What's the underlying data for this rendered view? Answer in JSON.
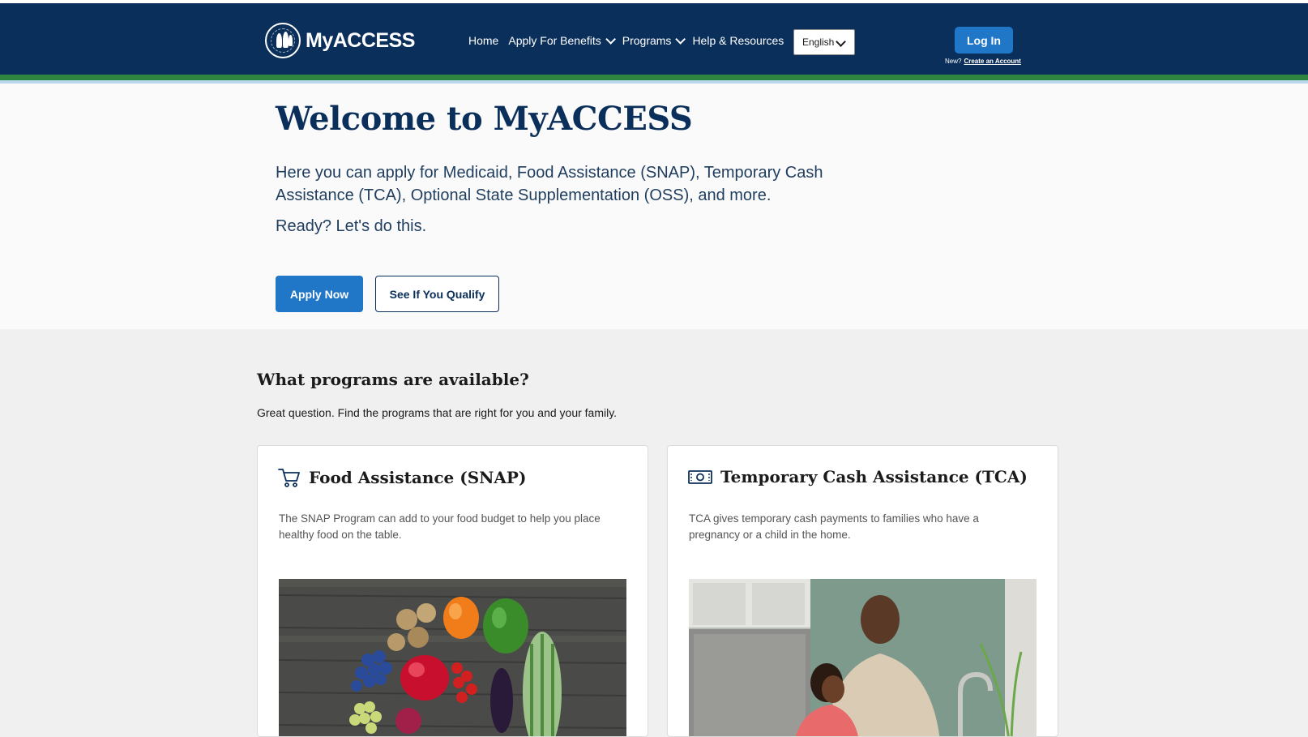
{
  "header": {
    "logo_text": "MyACCESS",
    "nav": [
      {
        "label": "Home"
      },
      {
        "label": "Apply For Benefits"
      },
      {
        "label": "Programs"
      },
      {
        "label": "Help & Resources"
      }
    ],
    "language": {
      "selected": "English"
    },
    "login_label": "Log In",
    "new_label": "New?",
    "create_account_label": "Create an Account"
  },
  "hero": {
    "title": "Welcome to MyACCESS",
    "text": "Here you can apply for Medicaid, Food Assistance (SNAP), Temporary Cash Assistance (TCA), Optional State Supplementation (OSS), and more.",
    "ready": "Ready? Let's do this.",
    "apply_label": "Apply Now",
    "qualify_label": "See If You Qualify"
  },
  "programs": {
    "title": "What programs are available?",
    "subtitle": "Great question. Find the programs that are right for you and your family.",
    "cards": [
      {
        "title": "Food Assistance (SNAP)",
        "icon": "shopping-cart-icon",
        "description": "The SNAP Program can add to your food budget to help you place healthy food on the table."
      },
      {
        "title": "Temporary Cash Assistance (TCA)",
        "icon": "cash-icon",
        "description": "TCA gives temporary cash payments to families who have a pregnancy or a child in the home."
      }
    ]
  },
  "colors": {
    "navy": "#0b2f5b",
    "button_blue": "#2076c7",
    "accent_green": "#2e8540"
  }
}
